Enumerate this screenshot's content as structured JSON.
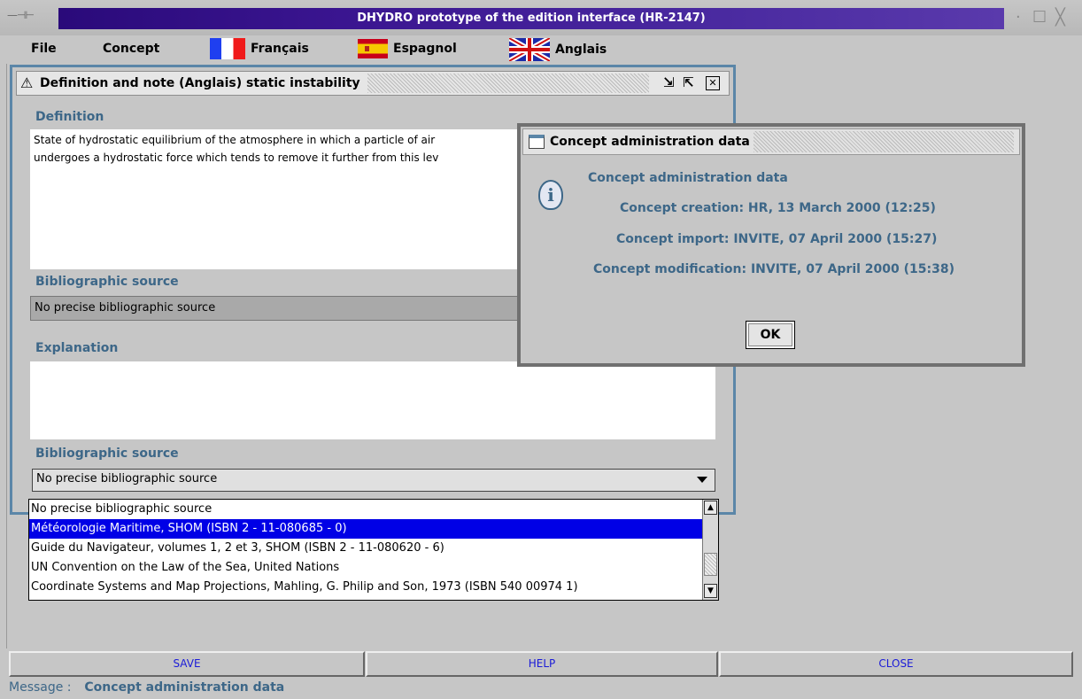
{
  "window": {
    "title": "DHYDRO prototype of the edition interface (HR-2147)",
    "controls": {
      "minimize": "·",
      "maximize": "☐",
      "close": "╳"
    },
    "grab": "—⊣⊢"
  },
  "menubar": {
    "file": "File",
    "concept": "Concept",
    "languages": [
      {
        "label": "Français",
        "flag": "fr-flag-icon"
      },
      {
        "label": "Espagnol",
        "flag": "es-flag-icon"
      },
      {
        "label": "Anglais",
        "flag": "uk-flag-icon"
      }
    ]
  },
  "frame": {
    "title": "Definition and note (Anglais) static instability",
    "definition_label": "Definition",
    "definition_line1": "State of hydrostatic equilibrium of the atmosphere in which a particle of air",
    "definition_line2": "undergoes a hydrostatic force which tends to remove it further from this lev",
    "bib_label_1": "Bibliographic source",
    "bib_value_1": "No precise bibliographic source",
    "explanation_label": "Explanation",
    "explanation_text": "",
    "bib_label_2": "Bibliographic source",
    "bib_value_2": "No precise bibliographic source"
  },
  "dropdown": {
    "items": [
      "No precise bibliographic source",
      "Météorologie Maritime, SHOM (ISBN 2 - 11-080685 - 0)",
      "Guide du Navigateur, volumes 1, 2 et 3, SHOM (ISBN 2 - 11-080620 - 6)",
      "UN Convention on the Law of the Sea, United Nations",
      "Coordinate Systems and Map Projections, Mahling, G. Philip and Son, 1973 (ISBN 540 00974 1)"
    ],
    "selected_index": 1
  },
  "dialog": {
    "title": "Concept administration data",
    "heading": "Concept administration data",
    "creation": "Concept creation: HR, 13 March 2000 (12:25)",
    "import": "Concept import: INVITE, 07 April 2000 (15:27)",
    "modification": "Concept modification: INVITE, 07 April 2000 (15:38)",
    "ok": "OK"
  },
  "bottom": {
    "save": "SAVE",
    "help": "HELP",
    "close": "CLOSE",
    "message_label": "Message :",
    "message_text": "Concept administration data"
  },
  "colors": {
    "accent_blue": "#3d6788",
    "selection": "#0000e6",
    "title_purple": "#3a1590"
  }
}
